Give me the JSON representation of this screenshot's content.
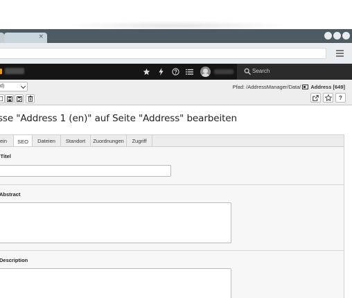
{
  "browser": {
    "tab_close_glyph": "×"
  },
  "topbar": {
    "search_label": "Search",
    "icons": [
      "star-icon",
      "bolt-icon",
      "help-icon",
      "list-icon"
    ],
    "accent_color": "#f49700"
  },
  "docheader": {
    "language_value": "d)",
    "path_prefix": "Pfad: /AddressManager/Data/",
    "record_title": "Address [649]",
    "help_label": "?"
  },
  "page": {
    "title": "sse \"Address 1 (en)\" auf Seite \"Address\" bearbeiten"
  },
  "tabs": [
    {
      "label": "ein",
      "active": false
    },
    {
      "label": "SEO",
      "active": true
    },
    {
      "label": "Dateien",
      "active": false
    },
    {
      "label": "Standort",
      "active": false
    },
    {
      "label": "Zuordnungen",
      "active": false
    },
    {
      "label": "Zugriff",
      "active": false
    }
  ],
  "fields": {
    "seo_title_label": "-Titel",
    "seo_title_value": "",
    "abstract_label": "Abstract",
    "abstract_value": "",
    "description_label": "Description",
    "description_value": ""
  }
}
